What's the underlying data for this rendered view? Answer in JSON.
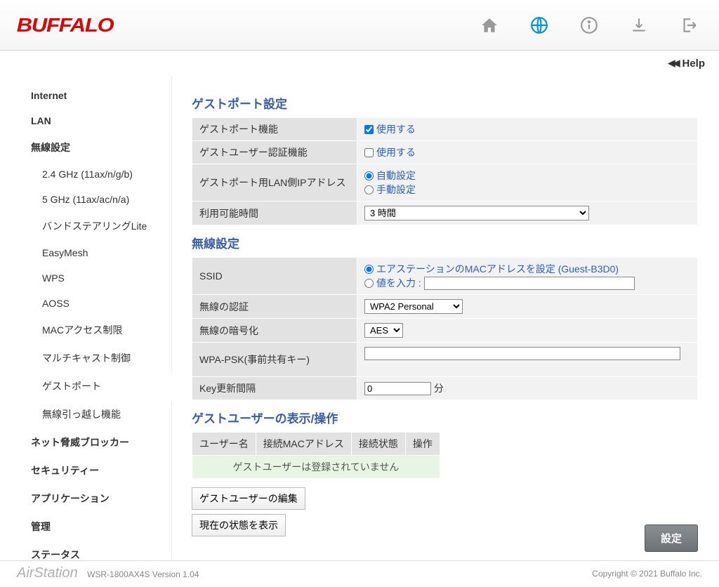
{
  "brand": "BUFFALO",
  "help": "Help",
  "sidebar": {
    "items": [
      {
        "label": "Internet",
        "top": true
      },
      {
        "label": "LAN",
        "top": true
      },
      {
        "label": "無線設定",
        "top": true
      },
      {
        "label": "2.4 GHz (11ax/n/g/b)",
        "sub": true
      },
      {
        "label": "5 GHz (11ax/ac/n/a)",
        "sub": true
      },
      {
        "label": "バンドステアリングLite",
        "sub": true
      },
      {
        "label": "EasyMesh",
        "sub": true
      },
      {
        "label": "WPS",
        "sub": true
      },
      {
        "label": "AOSS",
        "sub": true
      },
      {
        "label": "MACアクセス制限",
        "sub": true
      },
      {
        "label": "マルチキャスト制御",
        "sub": true
      },
      {
        "label": "ゲストポート",
        "sub": true,
        "active": true
      },
      {
        "label": "無線引っ越し機能",
        "sub": true
      },
      {
        "label": "ネット脅威ブロッカー",
        "top": true
      },
      {
        "label": "セキュリティー",
        "top": true
      },
      {
        "label": "アプリケーション",
        "top": true
      },
      {
        "label": "管理",
        "top": true
      },
      {
        "label": "ステータス",
        "top": true
      }
    ]
  },
  "sections": {
    "guestport": "ゲストポート設定",
    "wireless": "無線設定",
    "userops": "ゲストユーザーの表示/操作"
  },
  "labels": {
    "guestport_enable": "ゲストポート機能",
    "guestuser_auth": "ゲストユーザー認証機能",
    "guest_lan_ip": "ゲストポート用LAN側IPアドレス",
    "avail_time": "利用可能時間",
    "ssid": "SSID",
    "auth": "無線の認証",
    "enc": "無線の暗号化",
    "psk": "WPA-PSK(事前共有キー)",
    "rekey": "Key更新間隔",
    "use": "使用する",
    "auto": "自動設定",
    "manual": "手動設定",
    "ssid_mac": "エアステーションのMACアドレスを設定 (Guest-B3D0)",
    "ssid_input": "値を入力 :",
    "minute": "分",
    "col_user": "ユーザー名",
    "col_mac": "接続MACアドレス",
    "col_state": "接続状態",
    "col_op": "操作",
    "no_users": "ゲストユーザーは登録されていません",
    "edit_users": "ゲストユーザーの編集",
    "show_status": "現在の状態を表示",
    "apply": "設定"
  },
  "values": {
    "guestport_enable": true,
    "guestuser_auth": false,
    "lan_ip": "auto",
    "avail_time": "3 時間",
    "ssid_mode": "mac",
    "ssid_custom": "",
    "auth": "WPA2 Personal",
    "enc": "AES",
    "rekey": "0"
  },
  "footer": {
    "station": "AirStation",
    "version": "WSR-1800AX4S Version 1.04",
    "copyright": "Copyright © 2021 Buffalo Inc."
  }
}
